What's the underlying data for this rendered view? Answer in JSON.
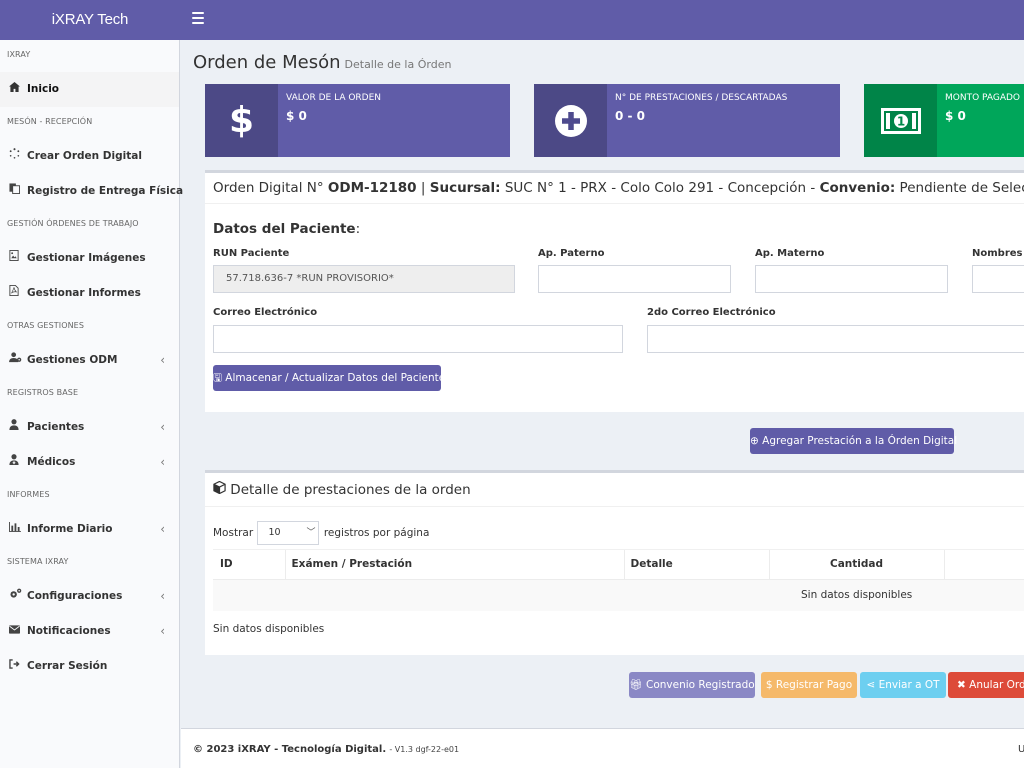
{
  "app": {
    "brand": "iXRAY Tech"
  },
  "sidebar": {
    "sections": {
      "s0": "iXRAY",
      "s1": "MESÓN - RECEPCIÓN",
      "s2": "GESTIÓN ÓRDENES DE TRABAJO",
      "s3": "OTRAS GESTIONES",
      "s4": "REGISTROS BASE",
      "s5": "INFORMES",
      "s6": "SISTEMA iXRAY"
    },
    "items": {
      "inicio": "Inicio",
      "crear_orden": "Crear Orden Digital",
      "registro_entrega": "Registro de Entrega Física",
      "gestionar_imagenes": "Gestionar Imágenes",
      "gestionar_informes": "Gestionar Informes",
      "gestiones_odm": "Gestiones ODM",
      "pacientes": "Pacientes",
      "medicos": "Médicos",
      "informe_diario": "Informe Diario",
      "configuraciones": "Configuraciones",
      "notificaciones": "Notificaciones",
      "cerrar_sesion": "Cerrar Sesión"
    }
  },
  "page": {
    "title": "Orden de Mesón",
    "subtitle": "Detalle de la Órden"
  },
  "infoboxes": {
    "valor": {
      "label": "VALOR DE LA ORDEN",
      "value": "$ 0"
    },
    "prestaciones": {
      "label": "N° DE PRESTACIONES / DESCARTADAS",
      "value": "0 - 0"
    },
    "monto": {
      "label": "MONTO PAGADO",
      "value": "$ 0"
    }
  },
  "order": {
    "prefix": "Orden Digital N°",
    "number": "ODM-12180",
    "separator": "|",
    "sucursal_label": "Sucursal:",
    "sucursal_value": "SUC N° 1 - PRX - Colo Colo 291 - Concepción -",
    "convenio_label": "Convenio:",
    "convenio_value": "Pendiente de Seleccion"
  },
  "patient": {
    "heading": "Datos del Paciente",
    "heading_colon": ":",
    "run_label": "RUN Paciente",
    "run_value": "57.718.636-7 *RUN PROVISORIO*",
    "paterno_label": "Ap. Paterno",
    "paterno_value": "",
    "materno_label": "Ap. Materno",
    "materno_value": "",
    "nombres_label": "Nombres",
    "nombres_value": "",
    "email_label": "Correo Electrónico",
    "email_value": "",
    "email2_label": "2do Correo Electrónico",
    "email2_value": "",
    "save_button": "Almacenar / Actualizar Datos del Paciente"
  },
  "add_button": "Agregar Prestación a la Órden Digital",
  "detail": {
    "title": "Detalle de prestaciones de la orden",
    "show_label": "Mostrar",
    "page_size": "10",
    "per_page_label": "registros por página",
    "columns": {
      "id": "ID",
      "examen": "Exámen / Prestación",
      "detalle": "Detalle",
      "cantidad": "Cantidad"
    },
    "empty_row": "Sin datos disponibles",
    "info": "Sin datos disponibles"
  },
  "actions": {
    "convenio": "Convenio Registrado",
    "pago": "$ Registrar Pago",
    "enviar": "Enviar a OT",
    "anular": "Anular Orden"
  },
  "footer": {
    "copyright": "© 2023 iXRAY - Tecnología Digital.",
    "version": "- V1.3 dgf-22-e01",
    "right_initial": "U"
  }
}
